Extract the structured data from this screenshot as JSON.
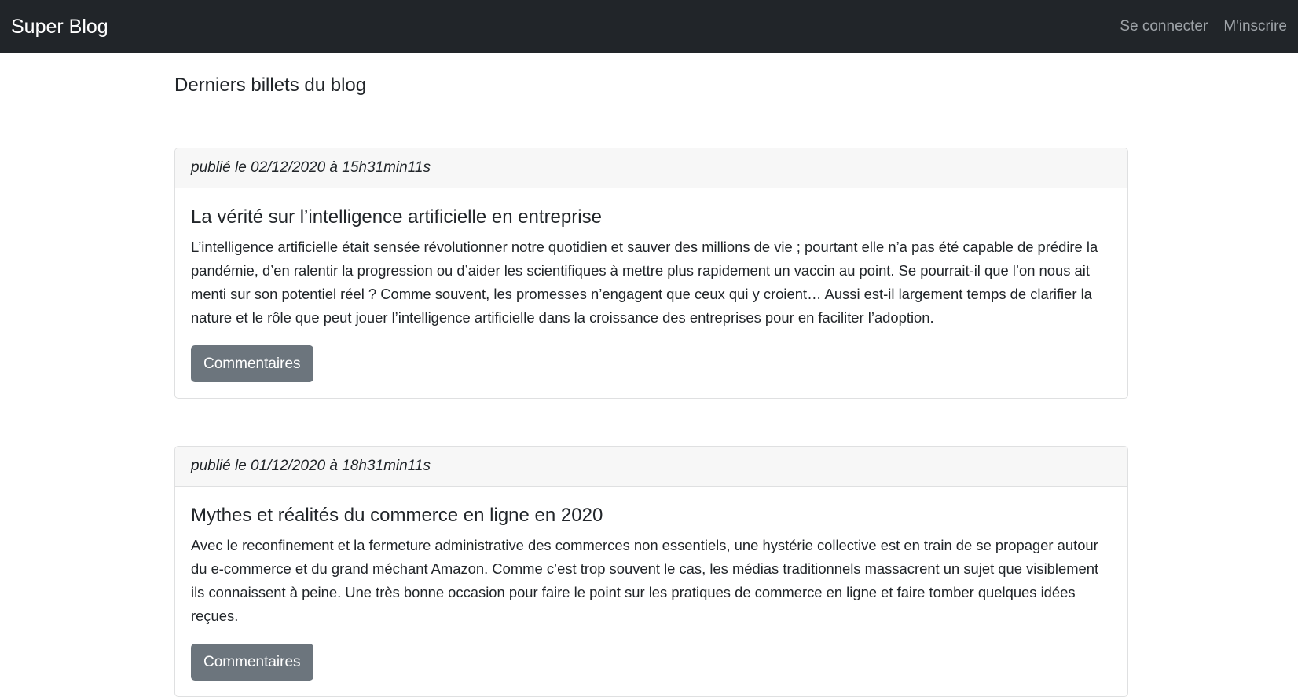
{
  "navbar": {
    "brand": "Super Blog",
    "links": [
      {
        "label": "Se connecter"
      },
      {
        "label": "M'inscrire"
      }
    ]
  },
  "main": {
    "title": "Derniers billets du blog",
    "posts": [
      {
        "published": "publié le 02/12/2020 à 15h31min11s",
        "title": "La vérité sur l’intelligence artificielle en entreprise",
        "excerpt": "L’intelligence artificielle était sensée révolutionner notre quotidien et sauver des millions de vie ; pourtant elle n’a pas été capable de prédire la pandémie, d’en ralentir la progression ou d’aider les scientifiques à mettre plus rapidement un vaccin au point. Se pourrait-il que l’on nous ait menti sur son potentiel réel ? Comme souvent, les promesses n’engagent que ceux qui y croient… Aussi est-il largement temps de clarifier la nature et le rôle que peut jouer l’intelligence artificielle dans la croissance des entreprises pour en faciliter l’adoption.",
        "button": "Commentaires"
      },
      {
        "published": "publié le 01/12/2020 à 18h31min11s",
        "title": "Mythes et réalités du commerce en ligne en 2020",
        "excerpt": "Avec le reconfinement et la fermeture administrative des commerces non essentiels, une hystérie collective est en train de se propager autour du e-commerce et du grand méchant Amazon. Comme c’est trop souvent le cas, les médias traditionnels massacrent un sujet que visiblement ils connaissent à peine. Une très bonne occasion pour faire le point sur les pratiques de commerce en ligne et faire tomber quelques idées reçues.",
        "button": "Commentaires"
      }
    ]
  },
  "colors": {
    "navbar_bg": "#212529",
    "nav_link": "#9ea3a8",
    "button_bg": "#6c757d",
    "card_header_bg": "#f7f7f7",
    "card_border": "#dfe0e1"
  }
}
